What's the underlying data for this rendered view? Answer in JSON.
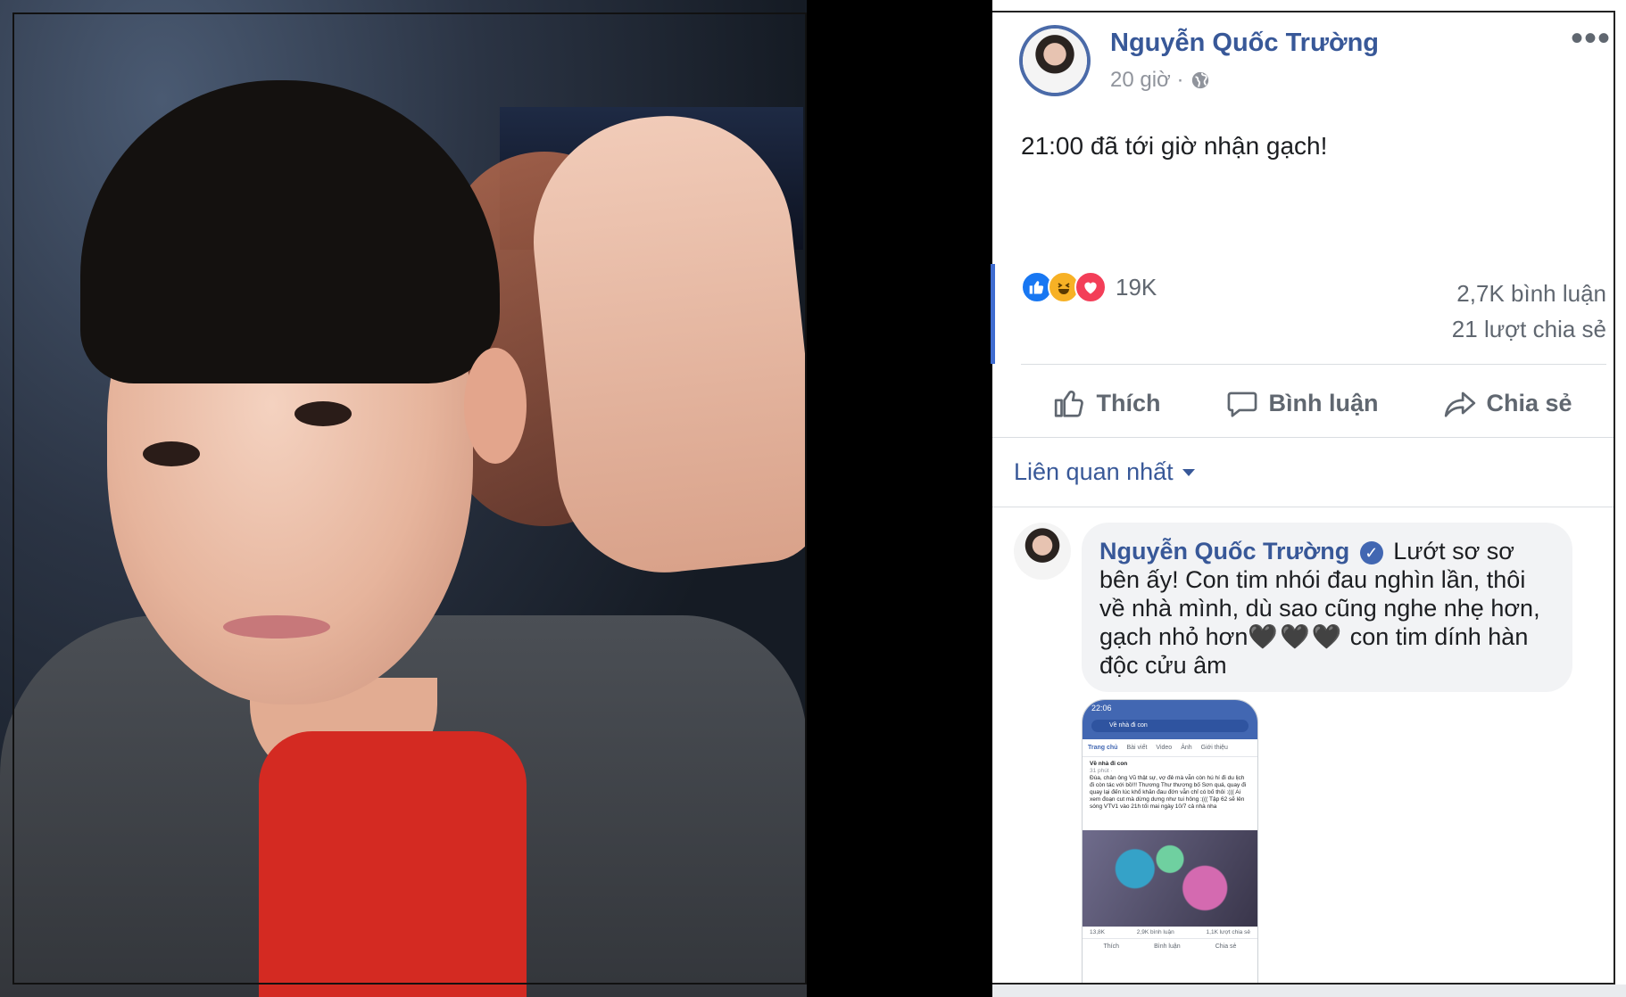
{
  "post": {
    "author": "Nguyễn Quốc Trường",
    "time": "20 giờ ·",
    "privacy_icon": "globe-icon",
    "text": "21:00 đã tới giờ nhận gạch!",
    "reactions": {
      "icons": [
        "like",
        "haha",
        "love"
      ],
      "count": "19K"
    },
    "comments_count": "2,7K bình luận",
    "shares_count": "21 lượt chia sẻ"
  },
  "actions": {
    "like": "Thích",
    "comment": "Bình luận",
    "share": "Chia sẻ"
  },
  "filter": {
    "label": "Liên quan nhất"
  },
  "comment": {
    "author": "Nguyễn Quốc Trường",
    "verified_icon": "verified-badge-icon",
    "text_before_hearts": "Lướt sơ sơ bên ấy! Con tim nhói đau nghìn lần, thôi về nhà mình, dù sao cũng nghe nhẹ hơn, gạch nhỏ hơn",
    "hearts": "🖤🖤🖤",
    "text_after_hearts": " con tim dính hàn độc cửu âm"
  },
  "attachment": {
    "status_time": "22:06",
    "search": "Về nhà đi con",
    "tabs": [
      "Trang chủ",
      "Bài viết",
      "Video",
      "Ảnh",
      "Giới thiệu"
    ],
    "page_name": "Về nhà đi con",
    "post_time": "31 phút ·",
    "post_text": "Đùa, chân ông Vũ thật sự, vợ đẻ mà vẫn còn hú hí đi du lịch đi còn tác với bồ!!! Thương Thư thương bố Sơn quá, quay đi quay lại đến lúc khổ khăn đau đớn vẫn chỉ có bố thôi :((( Ai xem đoạn cut mà dừng dưng như tui hông :((( Tập 62 sẽ lên sóng VTV1 vào 21h tối mai ngày 10/7 cả nhà nha",
    "reactions": "13,8K",
    "comments": "2,9K bình luận",
    "shares": "1,1K lượt chia sẻ",
    "acts": [
      "Thích",
      "Bình luận",
      "Chia sẻ"
    ]
  },
  "colors": {
    "link": "#385898",
    "meta": "#90949c",
    "accent": "#3f6cd0"
  }
}
